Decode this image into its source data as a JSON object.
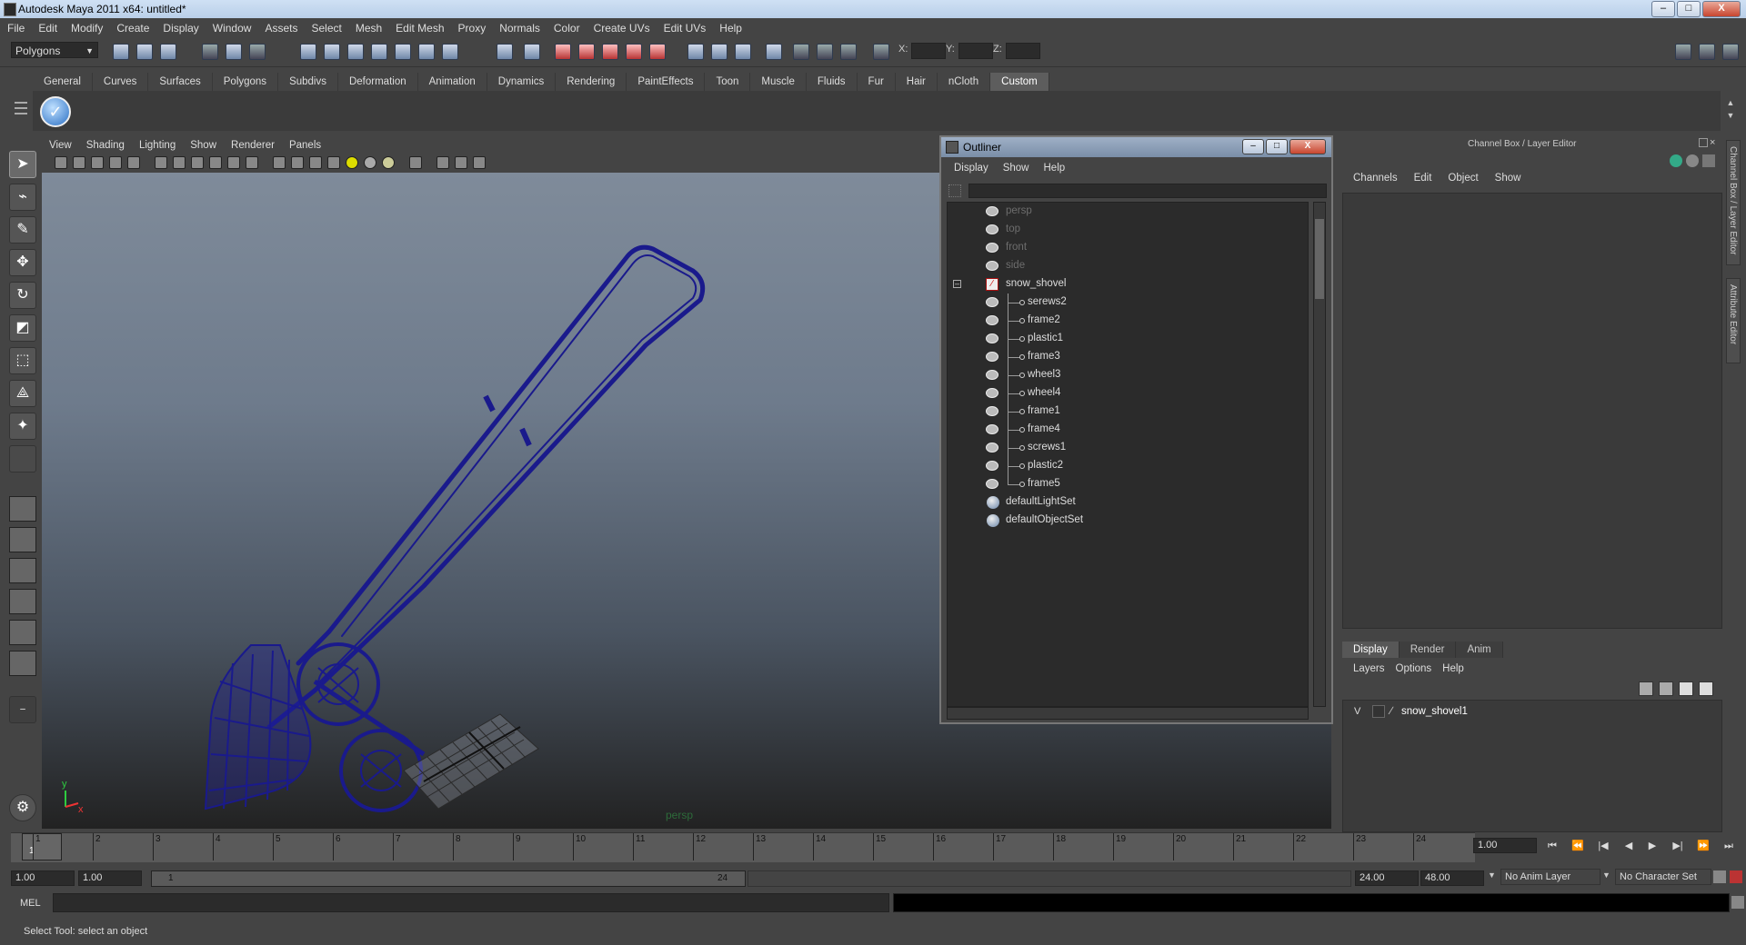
{
  "window": {
    "title": "Autodesk Maya 2011 x64: untitled*",
    "min": "–",
    "max": "□",
    "close": "X"
  },
  "menubar": [
    "File",
    "Edit",
    "Modify",
    "Create",
    "Display",
    "Window",
    "Assets",
    "Select",
    "Mesh",
    "Edit Mesh",
    "Proxy",
    "Normals",
    "Color",
    "Create UVs",
    "Edit UVs",
    "Help"
  ],
  "status_line": {
    "mode": "Polygons",
    "x_label": "X:",
    "y_label": "Y:",
    "z_label": "Z:"
  },
  "shelf_tabs": [
    "General",
    "Curves",
    "Surfaces",
    "Polygons",
    "Subdivs",
    "Deformation",
    "Animation",
    "Dynamics",
    "Rendering",
    "PaintEffects",
    "Toon",
    "Muscle",
    "Fluids",
    "Fur",
    "Hair",
    "nCloth",
    "Custom"
  ],
  "shelf_active": "Custom",
  "viewport": {
    "menu": [
      "View",
      "Shading",
      "Lighting",
      "Show",
      "Renderer",
      "Panels"
    ],
    "camera": "persp"
  },
  "outliner": {
    "title": "Outliner",
    "menu": [
      "Display",
      "Show",
      "Help"
    ],
    "items": [
      {
        "label": "persp",
        "kind": "camera",
        "dim": true
      },
      {
        "label": "top",
        "kind": "camera",
        "dim": true
      },
      {
        "label": "front",
        "kind": "camera",
        "dim": true
      },
      {
        "label": "side",
        "kind": "camera",
        "dim": true
      },
      {
        "label": "snow_shovel",
        "kind": "group"
      },
      {
        "label": "serews2",
        "kind": "child"
      },
      {
        "label": "frame2",
        "kind": "child"
      },
      {
        "label": "plastic1",
        "kind": "child"
      },
      {
        "label": "frame3",
        "kind": "child"
      },
      {
        "label": "wheel3",
        "kind": "child"
      },
      {
        "label": "wheel4",
        "kind": "child"
      },
      {
        "label": "frame1",
        "kind": "child"
      },
      {
        "label": "frame4",
        "kind": "child"
      },
      {
        "label": "screws1",
        "kind": "child"
      },
      {
        "label": "plastic2",
        "kind": "child"
      },
      {
        "label": "frame5",
        "kind": "child"
      },
      {
        "label": "defaultLightSet",
        "kind": "set"
      },
      {
        "label": "defaultObjectSet",
        "kind": "set"
      }
    ]
  },
  "channel_box": {
    "title": "Channel Box / Layer Editor",
    "menu": [
      "Channels",
      "Edit",
      "Object",
      "Show"
    ],
    "layer_tabs": [
      "Display",
      "Render",
      "Anim"
    ],
    "layer_menu": [
      "Layers",
      "Options",
      "Help"
    ],
    "layers": [
      {
        "visible": "V",
        "name": "snow_shovel1"
      }
    ],
    "side_tabs": [
      "Channel Box / Layer Editor",
      "Attribute Editor"
    ]
  },
  "time_slider": {
    "ticks": [
      "1",
      "2",
      "3",
      "4",
      "5",
      "6",
      "7",
      "8",
      "9",
      "10",
      "11",
      "12",
      "13",
      "14",
      "15",
      "16",
      "17",
      "18",
      "19",
      "20",
      "21",
      "22",
      "23",
      "24"
    ],
    "current": "1",
    "current_field": "1.00"
  },
  "range": {
    "start": "1.00",
    "anim_start": "1.00",
    "range_start": "1",
    "range_end": "24",
    "anim_end": "24.00",
    "end": "48.00",
    "anim_layer": "No Anim Layer",
    "char_set": "No Character Set"
  },
  "command_line": {
    "label": "MEL"
  },
  "help_line": "Select Tool: select an object",
  "colors": {
    "wireframe": "#1a1a8c",
    "viewport_top": "#7f8b9a",
    "viewport_bottom": "#222222",
    "bg": "#444444"
  }
}
